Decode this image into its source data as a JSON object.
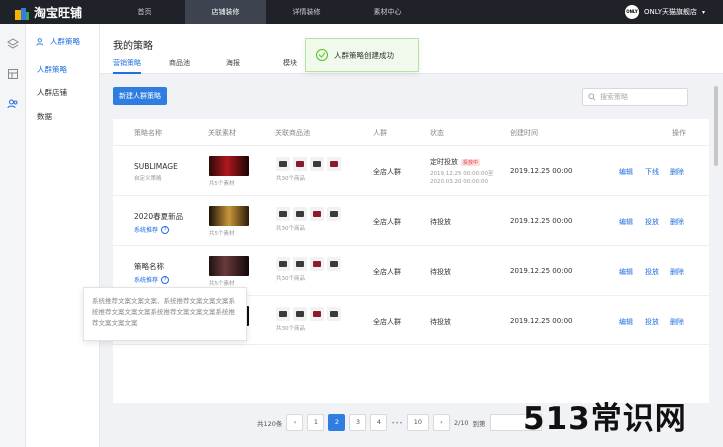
{
  "topbar": {
    "app_name": "淘宝旺铺",
    "nav": [
      "首页",
      "店铺装修",
      "详情装修",
      "素材中心"
    ],
    "active_nav": 1,
    "brand_logo_text": "ONLY",
    "shop_name": "ONLY天猫旗舰店"
  },
  "sidemenu": {
    "header": "人群策略",
    "items": [
      "人群策略",
      "人群店铺",
      "数据"
    ]
  },
  "page": {
    "title": "我的策略",
    "tabs": [
      "营销策略",
      "商品池",
      "海报",
      "模块"
    ],
    "toast": "人群策略创建成功",
    "new_button": "新建人群策略",
    "search_placeholder": "搜索策略"
  },
  "table": {
    "columns": [
      "策略名称",
      "关联素材",
      "关联商品池",
      "人群",
      "状态",
      "创建时间",
      "操作"
    ],
    "rows": [
      {
        "name": "SUBLIMAGE",
        "sub": "自定义策略",
        "material": "共5个素材",
        "products": "共30个商品",
        "crowd": "全店人群",
        "status": "定时投放",
        "status_badge": "投放中",
        "status_time": "2019.12.25 00:00:00至 2020.03.20 00:00:00",
        "created": "2019.12.25 00:00",
        "actions": [
          "编辑",
          "下线",
          "删除"
        ]
      },
      {
        "name": "2020春夏新品",
        "sub": "系统推荐",
        "material": "共5个素材",
        "products": "共30个商品",
        "crowd": "全店人群",
        "status": "待投放",
        "created": "2019.12.25 00:00",
        "actions": [
          "编辑",
          "投放",
          "删除"
        ]
      },
      {
        "name": "策略名称",
        "sub": "系统推荐",
        "material": "共5个素材",
        "products": "共30个商品",
        "crowd": "全店人群",
        "status": "待投放",
        "created": "2019.12.25 00:00",
        "actions": [
          "编辑",
          "投放",
          "删除"
        ]
      },
      {
        "name": "",
        "sub": "",
        "material": "",
        "products": "共30个商品",
        "crowd": "全店人群",
        "status": "待投放",
        "created": "2019.12.25 00:00",
        "actions": [
          "编辑",
          "投放",
          "删除"
        ]
      }
    ]
  },
  "tooltip": "系统推荐文案文案文案、系统推荐文案文案文案系统推荐文案文案文案系统推荐文案文案文案系统推荐文案文案文案",
  "pagination": {
    "total": "共120条",
    "pages": [
      "1",
      "2",
      "3",
      "4",
      "•••",
      "10"
    ],
    "current": "2",
    "page_info": "2/10",
    "goto_label": "到第"
  },
  "watermark": "513常识网",
  "colors": {
    "accent": "#2f7de1",
    "topbar": "#1f2329",
    "success": "#52c41a"
  }
}
